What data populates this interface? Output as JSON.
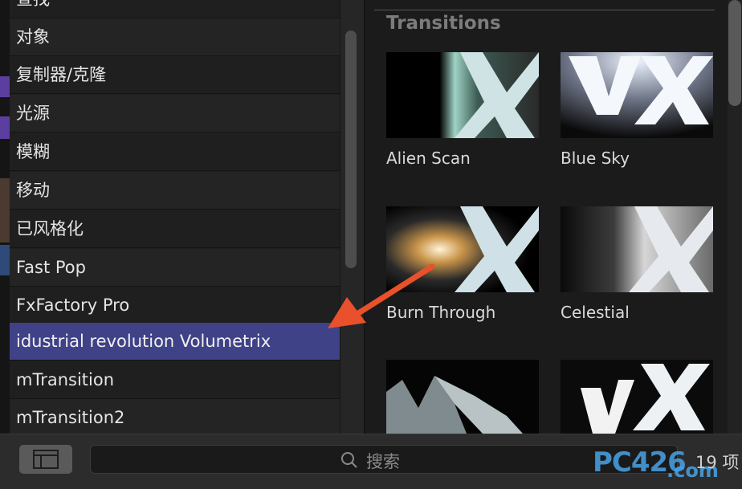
{
  "categories": [
    {
      "label": "查找"
    },
    {
      "label": "对象"
    },
    {
      "label": "复制器/克隆"
    },
    {
      "label": "光源"
    },
    {
      "label": "模糊"
    },
    {
      "label": "移动"
    },
    {
      "label": "已风格化"
    },
    {
      "label": "Fast Pop"
    },
    {
      "label": "FxFactory Pro"
    },
    {
      "label": "idustrial revolution Volumetrix",
      "selected": true
    },
    {
      "label": "mTransition"
    },
    {
      "label": "mTransition2"
    }
  ],
  "browser": {
    "section_title": "Transitions",
    "tiles": [
      {
        "label": "Alien Scan",
        "thumbnail_icon": "vx-logo-icon"
      },
      {
        "label": "Blue Sky",
        "thumbnail_icon": "vx-logo-icon"
      },
      {
        "label": "Burn Through",
        "thumbnail_icon": "vx-logo-icon"
      },
      {
        "label": "Celestial",
        "thumbnail_icon": "vx-logo-icon"
      },
      {
        "label": "",
        "thumbnail_icon": "vx-logo-icon"
      },
      {
        "label": "",
        "thumbnail_icon": "vx-logo-icon"
      }
    ]
  },
  "bottom_bar": {
    "layout_button_icon": "layout-panel-icon",
    "search_icon": "search-icon",
    "search_placeholder": "搜索",
    "item_count": "19 项",
    "watermark_main": "PC426",
    "watermark_suffix": ".com"
  },
  "colors": {
    "selected_row": "#3f4287",
    "annotation_arrow": "#e8512b",
    "watermark": "#4aa3e6"
  }
}
